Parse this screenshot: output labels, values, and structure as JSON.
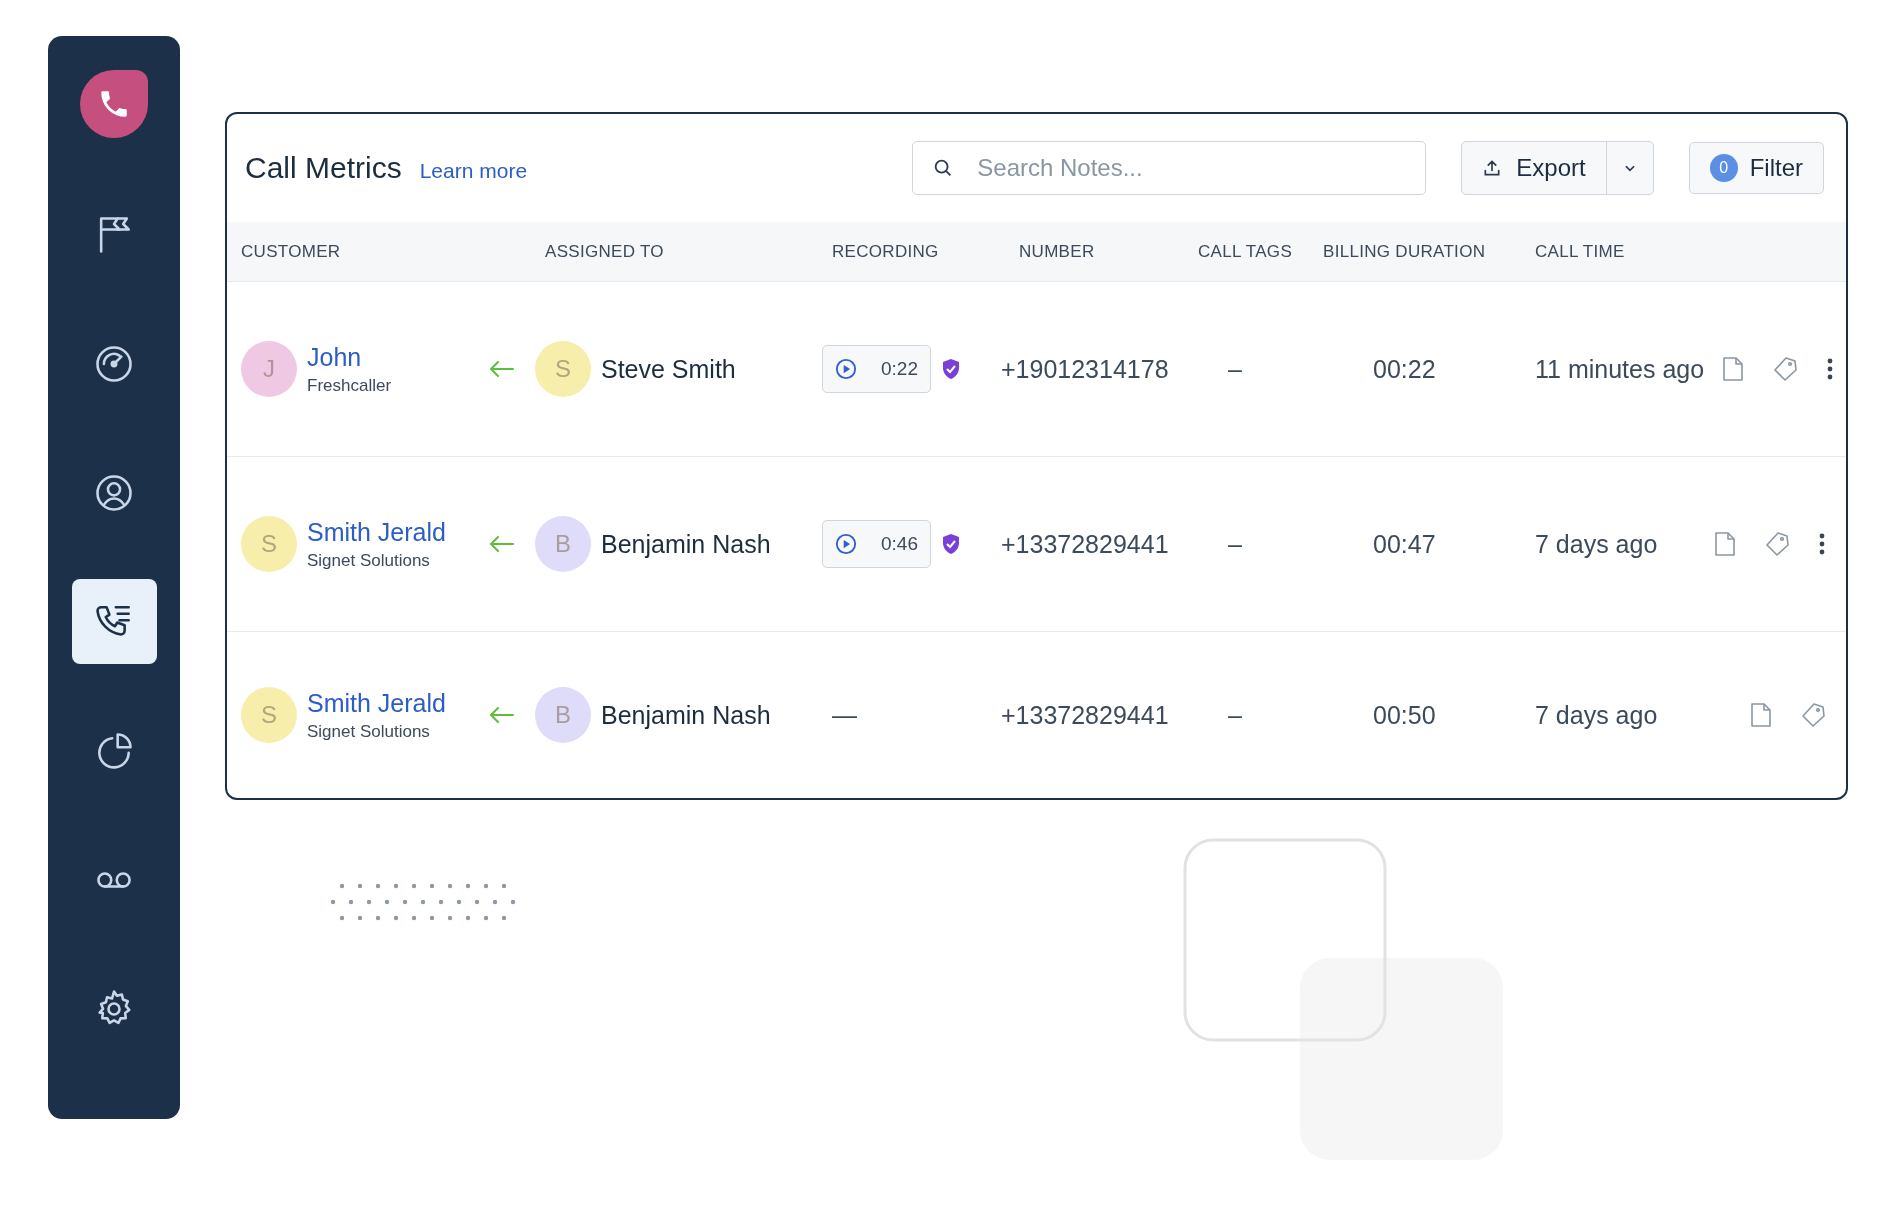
{
  "sidebar": {
    "items": [
      {
        "kind": "flag",
        "selected": false
      },
      {
        "kind": "gauge",
        "selected": false
      },
      {
        "kind": "user",
        "selected": false
      },
      {
        "kind": "calls",
        "selected": true
      },
      {
        "kind": "pie",
        "selected": false
      },
      {
        "kind": "voicemail",
        "selected": false
      },
      {
        "kind": "gear",
        "selected": false
      }
    ]
  },
  "header": {
    "title": "Call Metrics",
    "learn_more": "Learn more",
    "search": {
      "placeholder": "Search Notes..."
    },
    "export": "Export",
    "filter": {
      "count": "0",
      "label": "Filter"
    }
  },
  "table": {
    "columns": [
      "CUSTOMER",
      "ASSIGNED TO",
      "RECORDING",
      "NUMBER",
      "CALL TAGS",
      "BILLING DURATION",
      "CALL TIME"
    ],
    "rows": [
      {
        "customer": {
          "initial": "J",
          "color": "#efc9e4",
          "name": "John",
          "company": "Freshcaller"
        },
        "agent": {
          "initial": "S",
          "color": "#f6eeaa",
          "name": "Steve Smith"
        },
        "recording": {
          "kind": "player",
          "duration": "0:22"
        },
        "number": "+19012314178",
        "call_tags": "–",
        "billing_duration": "00:22",
        "call_time": "11 minutes ago",
        "more_menu": true
      },
      {
        "customer": {
          "initial": "S",
          "color": "#f6eeaa",
          "name": "Smith Jerald",
          "company": "Signet Solutions"
        },
        "agent": {
          "initial": "B",
          "color": "#dedcf8",
          "name": "Benjamin Nash"
        },
        "recording": {
          "kind": "player",
          "duration": "0:46"
        },
        "number": "+13372829441",
        "call_tags": "–",
        "billing_duration": "00:47",
        "call_time": "7 days ago",
        "more_menu": true
      },
      {
        "customer": {
          "initial": "S",
          "color": "#f6eeaa",
          "name": "Smith Jerald",
          "company": "Signet Solutions"
        },
        "agent": {
          "initial": "B",
          "color": "#dedcf8",
          "name": "Benjamin Nash"
        },
        "recording": {
          "kind": "none",
          "text": "—"
        },
        "number": "+13372829441",
        "call_tags": "–",
        "billing_duration": "00:50",
        "call_time": "7 days ago",
        "more_menu": false
      }
    ]
  }
}
